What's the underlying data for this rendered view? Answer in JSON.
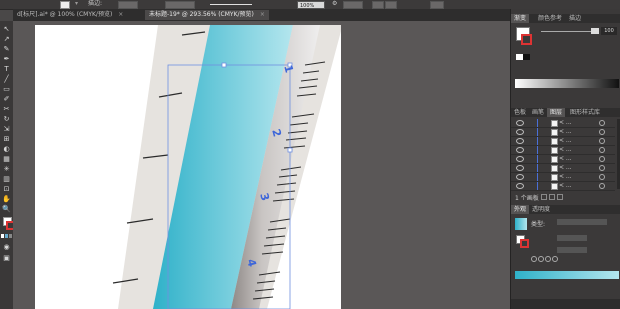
{
  "control_bar": {
    "stroke_label": "描边:",
    "opacity_value": "100%",
    "style_label": "样式:"
  },
  "document_tabs": [
    {
      "label": "d[标尺].ai* @ 100% (CMYK/预览)",
      "active": false
    },
    {
      "label": "未标题-19* @ 293.56% (CMYK/预览)",
      "active": true
    }
  ],
  "tools": [
    "↖",
    "↗",
    "✎",
    "✒",
    "T",
    "╱",
    "▭",
    "✐",
    "✂",
    "↻",
    "⇲",
    "⊞",
    "◐",
    "▦",
    "✳",
    "▥",
    "⊡",
    "✋",
    "🔍"
  ],
  "ruler": {
    "numbers": [
      "1",
      "2",
      "3",
      "4"
    ],
    "colors": {
      "strip": "#e6e3df",
      "gradient_left": "#2fb1c9",
      "gradient_right": "#b4e6ee",
      "shadow_left": "#8d8886",
      "shadow_right": "#efeeee",
      "number_color": "#3f67d9",
      "tick_color": "#2b2b2b"
    }
  },
  "panels": {
    "gradient_tabs": [
      "渐变",
      "颜色参考",
      "描边"
    ],
    "gradient_value": "100",
    "layer_tabs": [
      "色板",
      "画笔",
      "图层",
      "图形样式库"
    ],
    "layer_rows": [
      "< ...",
      "< ...",
      "< ...",
      "< ...",
      "< ...",
      "< ...",
      "< ...",
      "< ..."
    ],
    "layer_count": "1 个画板",
    "appearance_tabs": [
      "外观",
      "透明度"
    ],
    "appearance_type_label": "类型:"
  }
}
